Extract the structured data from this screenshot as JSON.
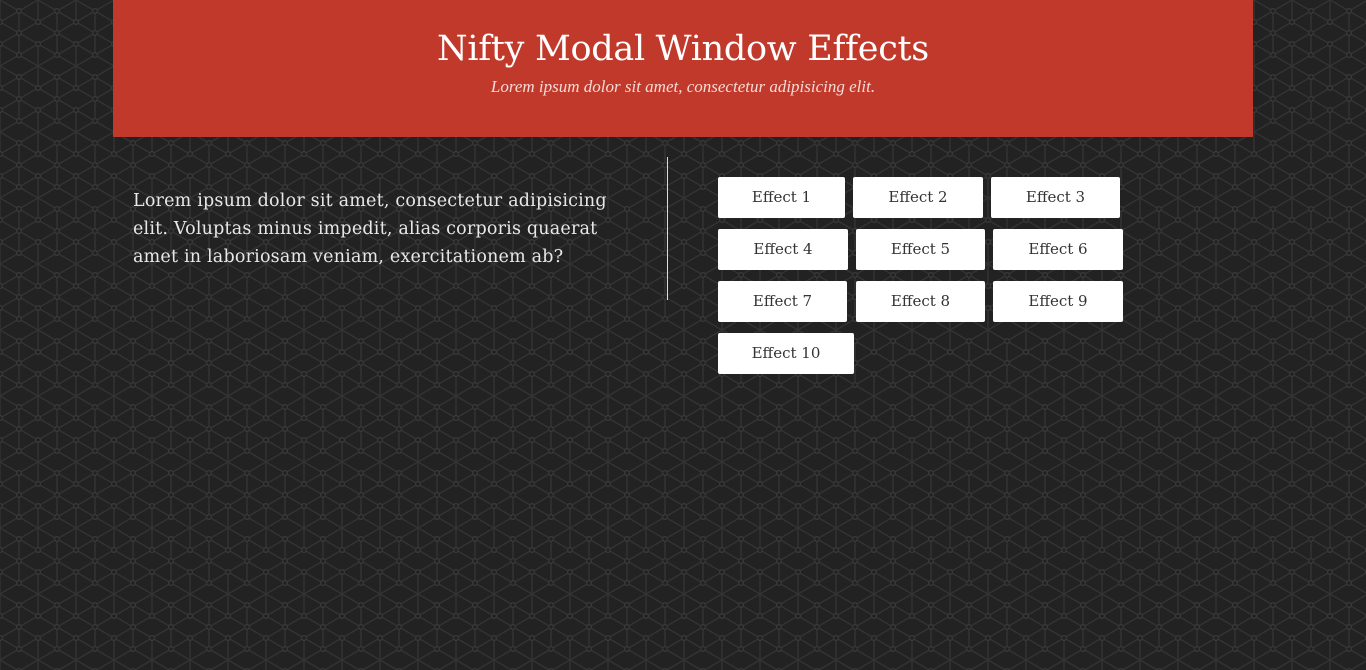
{
  "header": {
    "title": "Nifty Modal Window Effects",
    "subtitle": "Lorem ipsum dolor sit amet, consectetur adipisicing elit."
  },
  "intro": {
    "text": "Lorem ipsum dolor sit amet, consectetur adipisicing elit. Voluptas minus impedit, alias corporis quaerat amet in laboriosam veniam, exercitationem ab?"
  },
  "effects": {
    "buttons": [
      "Effect 1",
      "Effect 2",
      "Effect 3",
      "Effect 4",
      "Effect 5",
      "Effect 6",
      "Effect 7",
      "Effect 8",
      "Effect 9",
      "Effect 10"
    ]
  },
  "colors": {
    "background": "#222222",
    "header": "#c0392b",
    "button": "#ffffff"
  }
}
